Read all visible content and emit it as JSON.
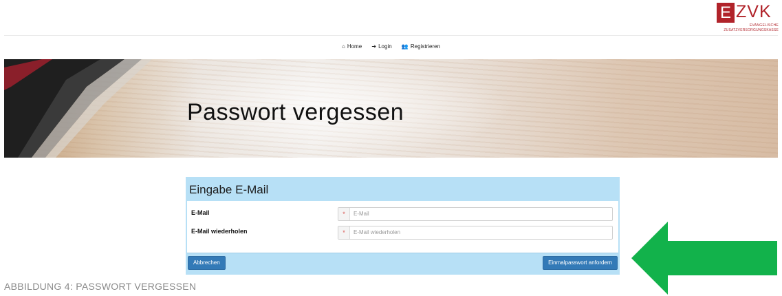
{
  "logo": {
    "e": "E",
    "zvk": "ZVK",
    "line1": "EVANGELISCHE",
    "line2": "ZUSATZVERSORGUNGSKASSE"
  },
  "nav": [
    {
      "icon": "home-icon",
      "glyph": "⌂",
      "label": "Home"
    },
    {
      "icon": "login-icon",
      "glyph": "➔",
      "label": "Login"
    },
    {
      "icon": "register-icon",
      "glyph": "👥",
      "label": "Registrieren"
    }
  ],
  "banner": {
    "title": "Passwort vergessen"
  },
  "form": {
    "heading": "Eingabe E-Mail",
    "fields": [
      {
        "label": "E-Mail",
        "required_mark": "*",
        "placeholder": "E-Mail",
        "value": ""
      },
      {
        "label": "E-Mail wiederholen",
        "required_mark": "*",
        "placeholder": "E-Mail wiederholen",
        "value": ""
      }
    ],
    "cancel_label": "Abbrechen",
    "submit_label": "Einmalpasswort anfordern"
  },
  "caption": "ABBILDUNG 4: PASSWORT VERGESSEN",
  "colors": {
    "brand": "#b1232a",
    "panel": "#b7e0f6",
    "button": "#337ab7",
    "arrow": "#12b24b"
  }
}
